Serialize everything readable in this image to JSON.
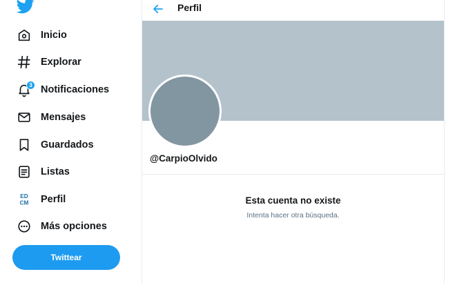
{
  "sidebar": {
    "logo_icon": "twitter-bird-icon",
    "items": [
      {
        "label": "Inicio",
        "icon": "home-icon"
      },
      {
        "label": "Explorar",
        "icon": "hashtag-icon"
      },
      {
        "label": "Notificaciones",
        "icon": "bell-icon",
        "badge": "3"
      },
      {
        "label": "Mensajes",
        "icon": "envelope-icon"
      },
      {
        "label": "Guardados",
        "icon": "bookmark-icon"
      },
      {
        "label": "Listas",
        "icon": "list-icon"
      },
      {
        "label": "Perfil",
        "icon": "profile-avatar-icon",
        "avatar_text": "ED\nCM"
      },
      {
        "label": "Más opciones",
        "icon": "more-options-icon"
      }
    ],
    "tweet_button": "Twittear"
  },
  "header": {
    "title": "Perfil",
    "back_icon": "arrow-left-icon"
  },
  "profile": {
    "handle": "@CarpioOlvido",
    "banner_color": "#b4c2cc",
    "avatar_color": "#8296a2"
  },
  "empty_state": {
    "title": "Esta cuenta no existe",
    "subtitle": "Intenta hacer otra búsqueda."
  },
  "colors": {
    "accent": "#1da1f2",
    "text": "#14171a",
    "secondary_text": "#5b7083"
  }
}
